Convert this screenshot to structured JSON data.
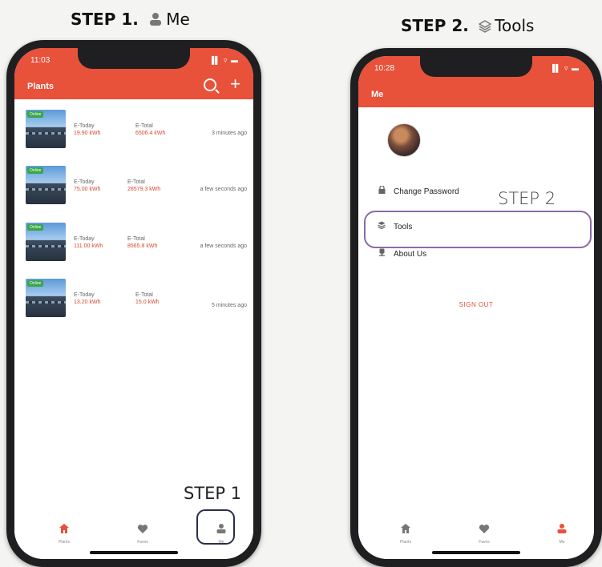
{
  "captions": {
    "step1": {
      "bold": "STEP 1.",
      "label": "Me",
      "icon": "person-icon"
    },
    "step2": {
      "bold": "STEP 2.",
      "label": "Tools",
      "icon": "layers-icon"
    }
  },
  "annotations": {
    "step1": "STEP 1",
    "step2": "STEP 2"
  },
  "phone1": {
    "time": "11:03",
    "status": "▐▌ ▿ ▬",
    "title": "Plants",
    "plants": [
      {
        "badge": "Online",
        "today_label": "E-Today",
        "today_value": "19.90 kWh",
        "total_label": "E-Total",
        "total_value": "6506.4 kWh",
        "ago": "3 minutes ago"
      },
      {
        "badge": "Online",
        "today_label": "E-Today",
        "today_value": "75.00 kWh",
        "total_label": "E-Total",
        "total_value": "28579.3 kWh",
        "ago": "a few seconds ago"
      },
      {
        "badge": "Online",
        "today_label": "E-Today",
        "today_value": "111.00 kWh",
        "total_label": "E-Total",
        "total_value": "8565.8 kWh",
        "ago": "a few seconds ago"
      },
      {
        "badge": "Online",
        "today_label": "E-Today",
        "today_value": "13.20 kWh",
        "total_label": "E-Total",
        "total_value": "15.0 kWh",
        "ago": "5 minutes ago"
      }
    ],
    "tabs": [
      {
        "label": "Plants",
        "icon": "home-icon",
        "active": true
      },
      {
        "label": "Favos",
        "icon": "heart-icon",
        "active": false
      },
      {
        "label": "Me",
        "icon": "person-icon",
        "active": false
      }
    ]
  },
  "phone2": {
    "time": "10:28",
    "status": "▐▌ ▿ ▬",
    "title": "Me",
    "menu": [
      {
        "label": "Change Password",
        "icon": "lock-icon"
      },
      {
        "label": "Tools",
        "icon": "tools-icon"
      },
      {
        "label": "About Us",
        "icon": "info-icon"
      }
    ],
    "signout": "SIGN OUT",
    "tabs": [
      {
        "label": "Plants",
        "icon": "home-icon",
        "active": false
      },
      {
        "label": "Favos",
        "icon": "heart-icon",
        "active": false
      },
      {
        "label": "Me",
        "icon": "person-icon",
        "active": true
      }
    ]
  },
  "colors": {
    "brand": "#e8513a",
    "online": "#3aa54a",
    "highlight": "#8b6aa8"
  }
}
